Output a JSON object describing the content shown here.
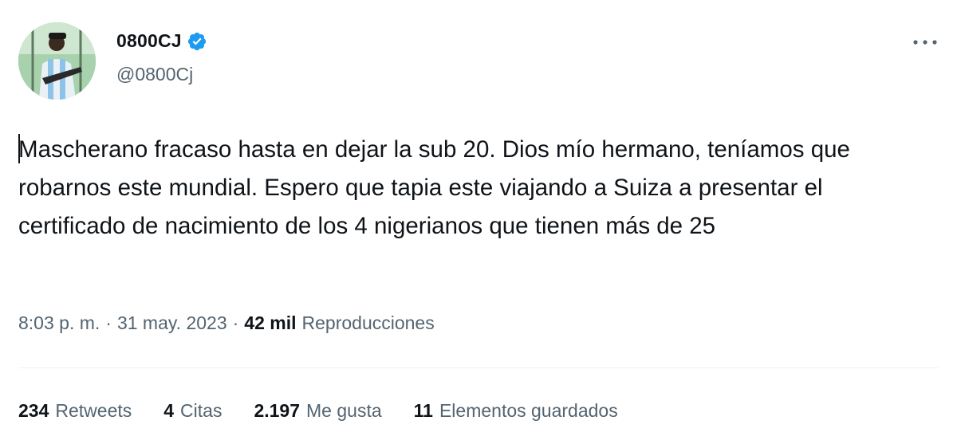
{
  "author": {
    "display_name": "0800CJ",
    "handle": "@0800Cj",
    "verified": true
  },
  "tweet": {
    "text": "Mascherano fracaso hasta en dejar la sub 20. Dios mío hermano, teníamos que robarnos este mundial. Espero que tapia este viajando a Suiza a presentar el certificado de nacimiento de los 4 nigerianos que tienen más de 25",
    "time": "8:03 p. m.",
    "separator": "·",
    "date": "31 may. 2023",
    "views_count": "42 mil",
    "views_label": "Reproducciones"
  },
  "stats": [
    {
      "count": "234",
      "label": "Retweets"
    },
    {
      "count": "4",
      "label": "Citas"
    },
    {
      "count": "2.197",
      "label": "Me gusta"
    },
    {
      "count": "11",
      "label": "Elementos guardados"
    }
  ],
  "icons": {
    "more": "more-horizontal-icon",
    "verified": "verified-badge-icon"
  },
  "colors": {
    "primary_text": "#0f1419",
    "secondary_text": "#536471",
    "verified_blue": "#1d9bf0",
    "divider": "#eff3f4"
  }
}
